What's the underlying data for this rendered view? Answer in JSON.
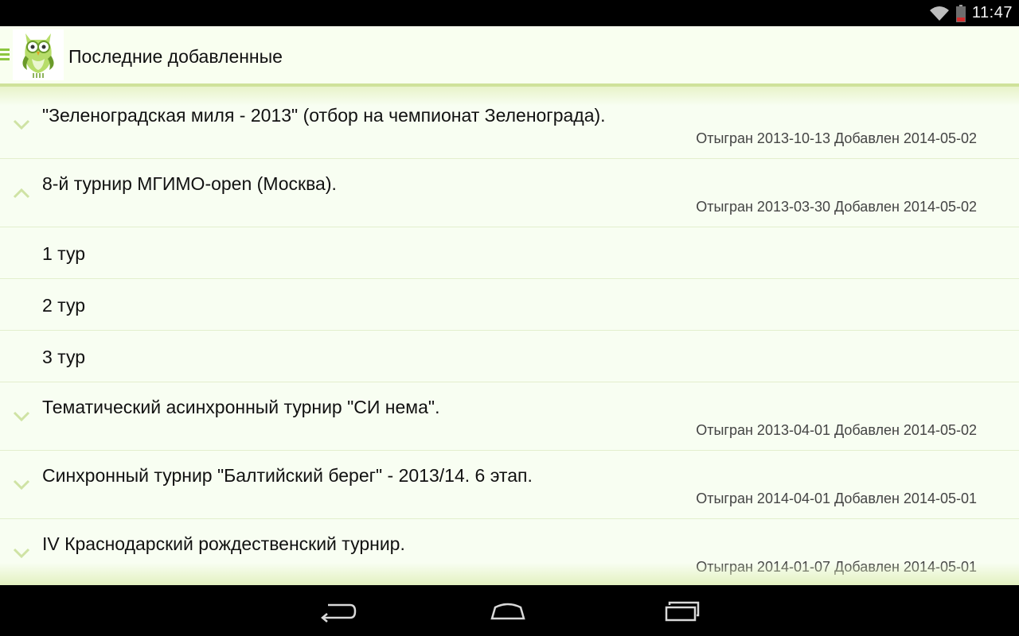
{
  "status_bar": {
    "time": "11:47",
    "icons": [
      "wifi-icon",
      "battery-icon"
    ]
  },
  "action_bar": {
    "title": "Последние добавленные",
    "icons": [
      "menu-icon",
      "owl-logo-icon"
    ]
  },
  "list": {
    "groups": [
      {
        "title": "\"Зеленоградская миля - 2013\" (отбор на чемпионат Зеленограда).",
        "meta": "Отыгран 2013-10-13 Добавлен 2014-05-02",
        "expanded": false
      },
      {
        "title": "8-й турнир МГИМО-open (Москва).",
        "meta": "Отыгран 2013-03-30 Добавлен 2014-05-02",
        "expanded": true,
        "children": [
          "1 тур",
          "2 тур",
          "3 тур"
        ]
      },
      {
        "title": "Тематический асинхронный турнир \"СИ нема\".",
        "meta": "Отыгран 2013-04-01 Добавлен 2014-05-02",
        "expanded": false
      },
      {
        "title": "Синхронный турнир \"Балтийский берег\" - 2013/14. 6 этап.",
        "meta": "Отыгран 2014-04-01 Добавлен 2014-05-01",
        "expanded": false
      },
      {
        "title": "IV Краснодарский рождественский турнир.",
        "meta": "Отыгран 2014-01-07 Добавлен 2014-05-01",
        "expanded": false
      }
    ]
  },
  "nav_bar": {
    "icons": [
      "back-icon",
      "home-icon",
      "recents-icon"
    ]
  },
  "colors": {
    "accent": "#8cc63f",
    "background": "#f8fef2",
    "divider": "#e3efcd"
  }
}
